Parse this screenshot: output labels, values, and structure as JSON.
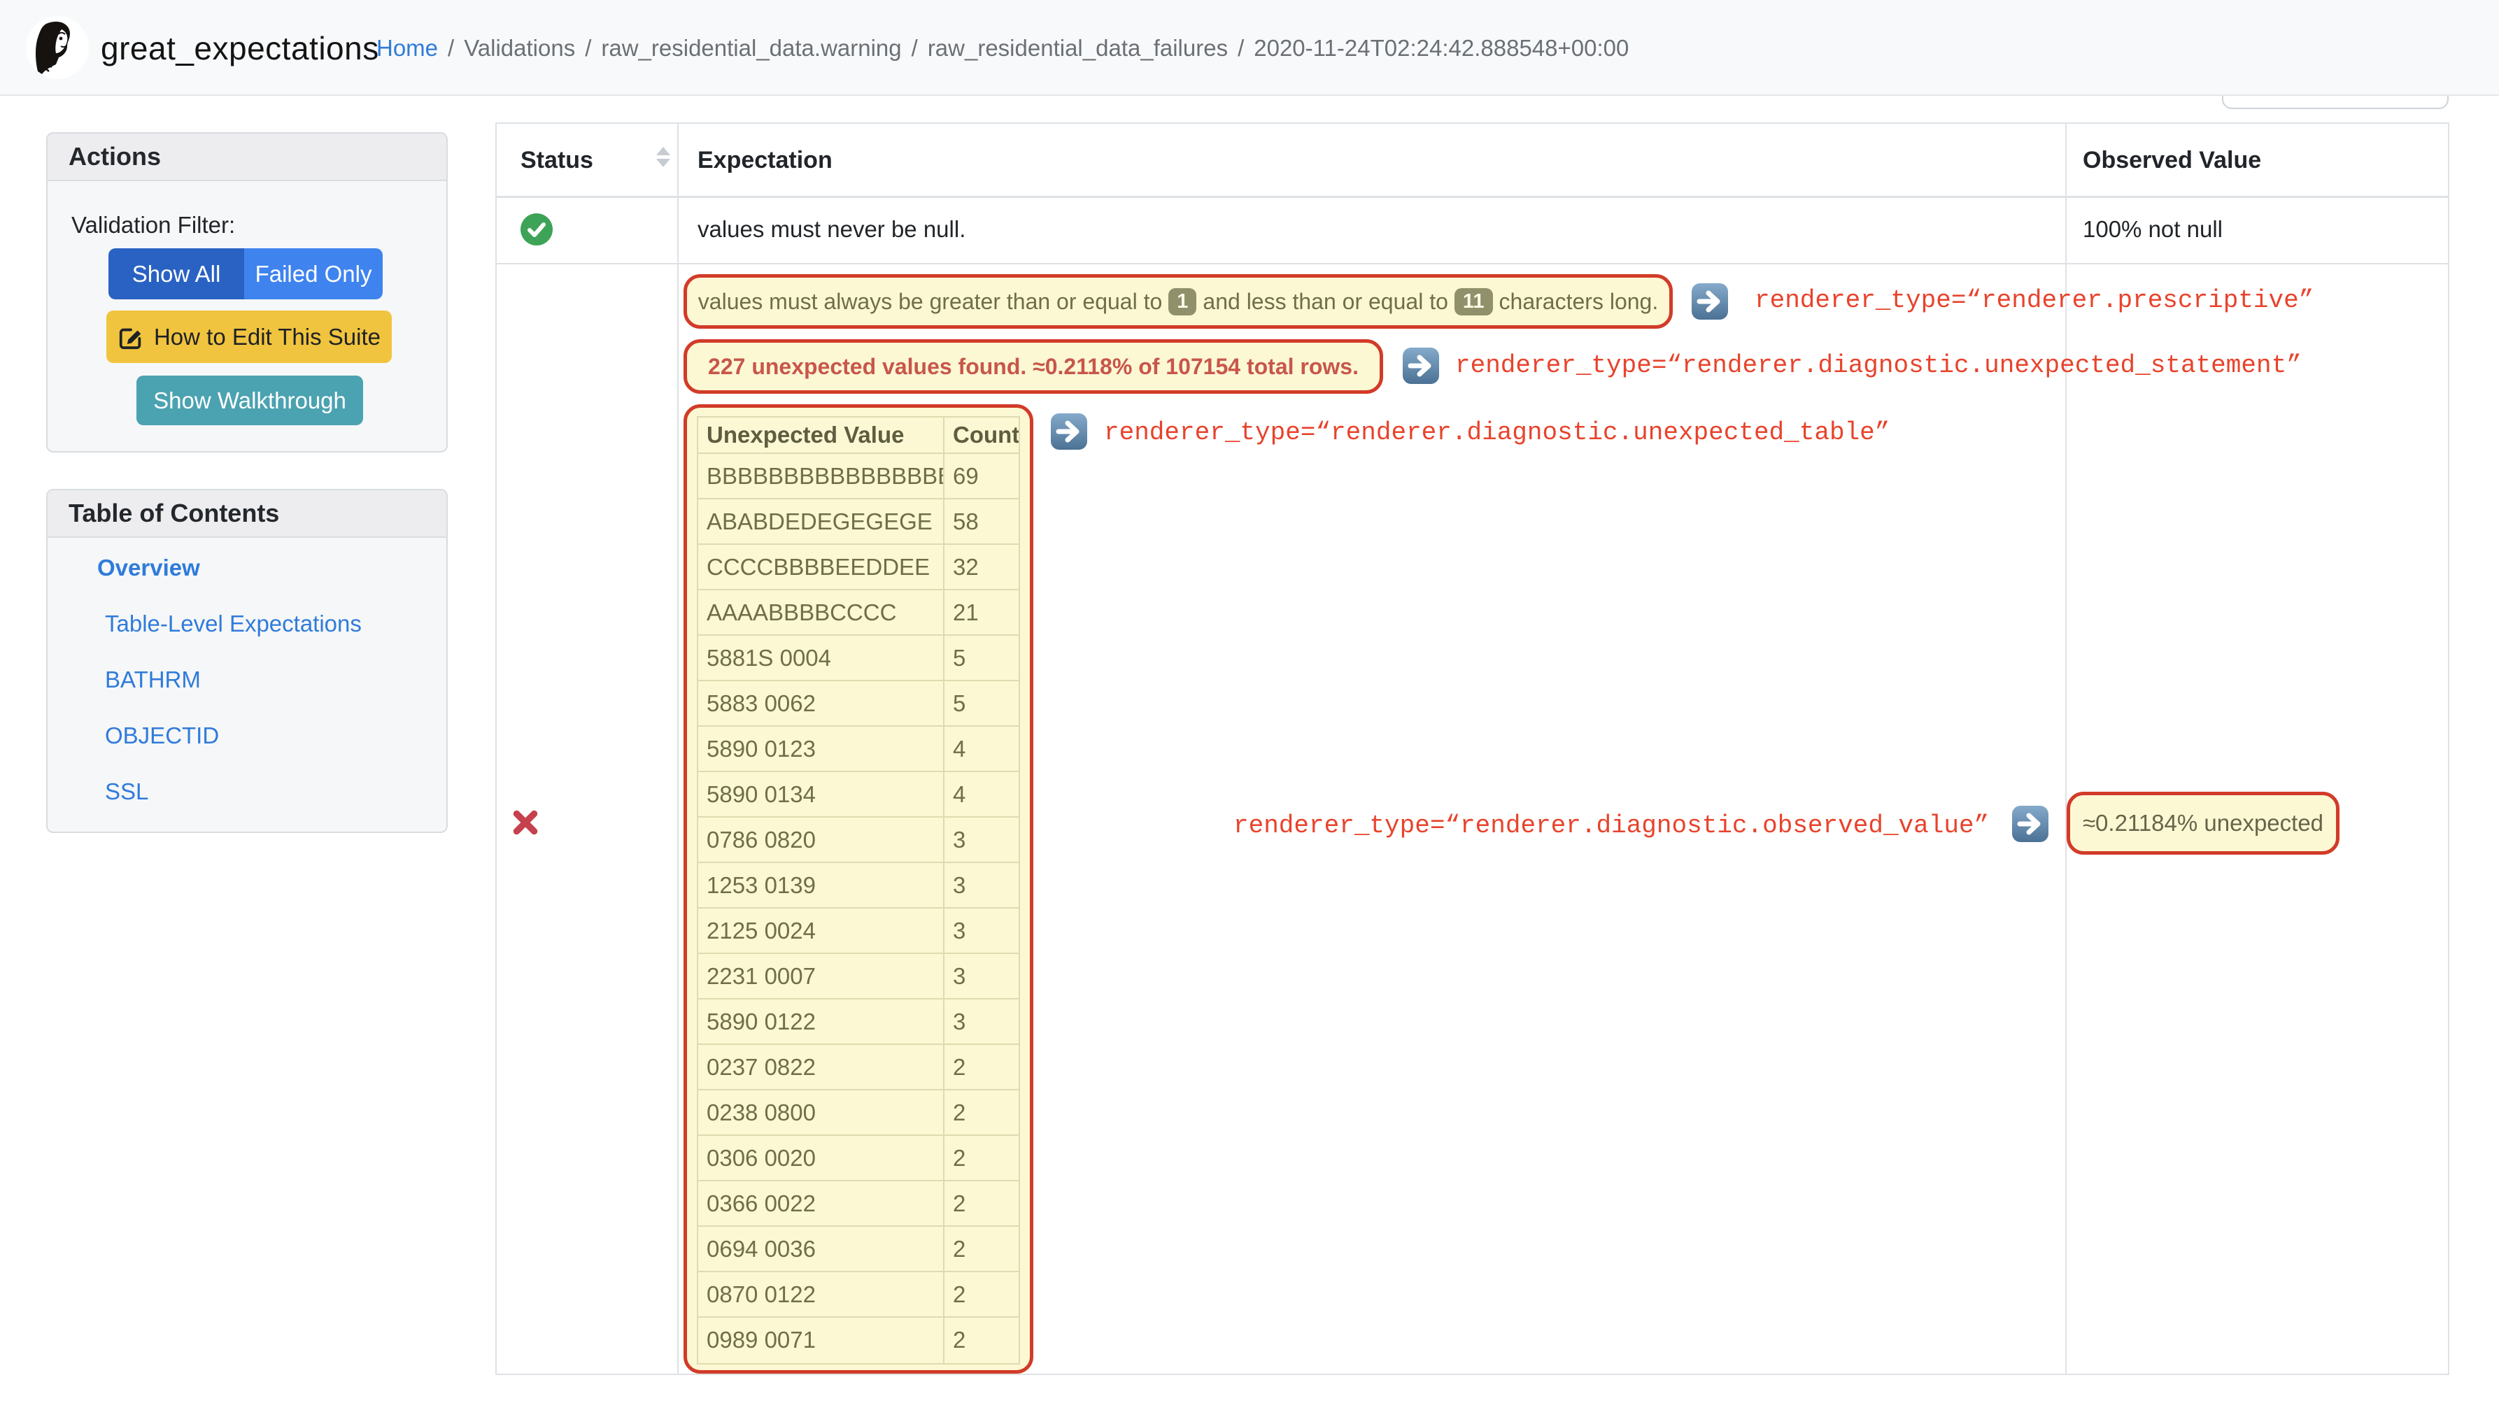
{
  "header": {
    "brand": "great_expectations",
    "breadcrumb": {
      "home": "Home",
      "separator": "/",
      "items": [
        "Validations",
        "raw_residential_data.warning",
        "raw_residential_data_failures",
        "2020-11-24T02:24:42.888548+00:00"
      ]
    }
  },
  "sidebar": {
    "actions": {
      "title": "Actions",
      "filter_label": "Validation Filter:",
      "buttons": {
        "show_all": "Show All",
        "failed_only": "Failed Only",
        "edit_suite": "How to Edit This Suite",
        "walkthrough": "Show Walkthrough"
      }
    },
    "toc": {
      "title": "Table of Contents",
      "items": [
        {
          "label": "Overview",
          "active": true
        },
        {
          "label": "Table-Level Expectations",
          "active": false
        },
        {
          "label": "BATHRM",
          "active": false
        },
        {
          "label": "OBJECTID",
          "active": false
        },
        {
          "label": "SSL",
          "active": false
        }
      ]
    }
  },
  "validation_table": {
    "columns": {
      "status": "Status",
      "expectation": "Expectation",
      "observed": "Observed Value"
    },
    "success_row": {
      "expectation": "values must never be null.",
      "observed": "100% not null"
    }
  },
  "annotations": {
    "prescriptive": {
      "text_before": "values must always be greater than or equal to",
      "min_badge": "1",
      "text_between": "and less than or equal to",
      "max_badge": "11",
      "text_after": "characters long.",
      "renderer": "renderer_type=“renderer.prescriptive”"
    },
    "unexpected_statement": {
      "text": "227 unexpected values found. ≈0.2118% of 107154 total rows.",
      "renderer": "renderer_type=“renderer.diagnostic.unexpected_statement”"
    },
    "unexpected_table": {
      "renderer": "renderer_type=“renderer.diagnostic.unexpected_table”",
      "columns": [
        "Unexpected Value",
        "Count"
      ],
      "rows": [
        [
          "BBBBBBBBBBBBBBBBBB",
          "69"
        ],
        [
          "ABABDEDEGEGEGE",
          "58"
        ],
        [
          "CCCCBBBBEEDDEE",
          "32"
        ],
        [
          "AAAABBBBCCCC",
          "21"
        ],
        [
          "5881S 0004",
          "5"
        ],
        [
          "5883 0062",
          "5"
        ],
        [
          "5890 0123",
          "4"
        ],
        [
          "5890 0134",
          "4"
        ],
        [
          "0786 0820",
          "3"
        ],
        [
          "1253 0139",
          "3"
        ],
        [
          "2125 0024",
          "3"
        ],
        [
          "2231 0007",
          "3"
        ],
        [
          "5890 0122",
          "3"
        ],
        [
          "0237 0822",
          "2"
        ],
        [
          "0238 0800",
          "2"
        ],
        [
          "0306 0020",
          "2"
        ],
        [
          "0366 0022",
          "2"
        ],
        [
          "0694 0036",
          "2"
        ],
        [
          "0870 0122",
          "2"
        ],
        [
          "0989 0071",
          "2"
        ]
      ]
    },
    "observed_value": {
      "renderer": "renderer_type=“renderer.diagnostic.observed_value”",
      "value": "≈0.21184% unexpected"
    }
  },
  "colors": {
    "annotation_border": "#d23b28",
    "annotation_bg": "#fcf8d4",
    "renderer_text": "#e8432c",
    "success_green": "#3ca357",
    "fail_red": "#c5414e",
    "link_blue": "#2f7bdb"
  }
}
